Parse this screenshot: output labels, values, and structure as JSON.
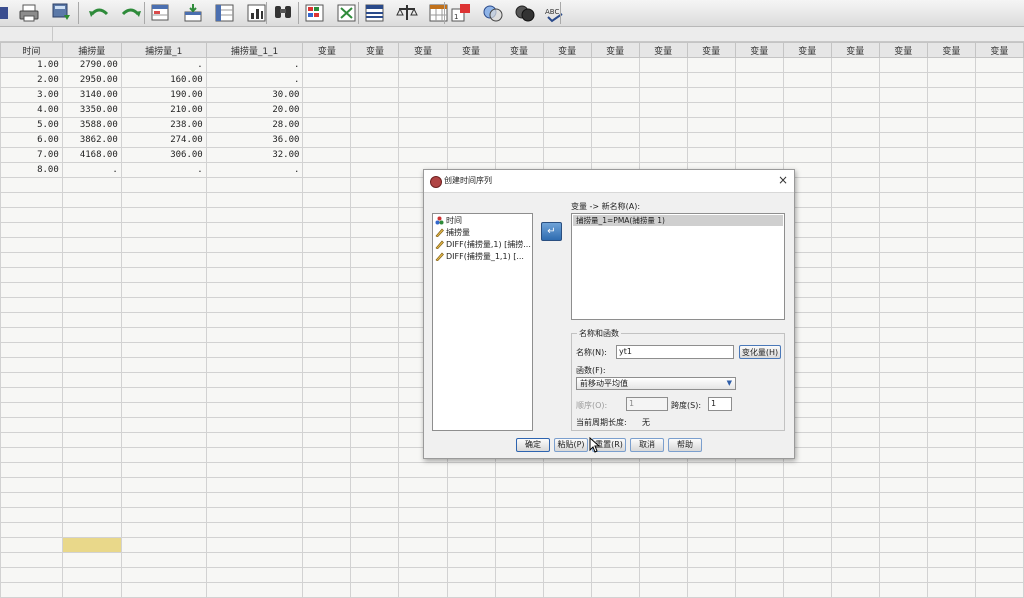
{
  "toolbar": {
    "icons": [
      "save-icon",
      "print-icon",
      "recall-dialog-icon",
      "undo-icon",
      "redo-icon",
      "goto-case-icon",
      "goto-variable-icon",
      "variables-icon",
      "run-descriptive-icon",
      "find-icon",
      "insert-cases-icon",
      "insert-variable-icon",
      "split-file-icon",
      "weight-cases-icon",
      "select-cases-icon",
      "value-labels-icon",
      "use-sets-icon",
      "show-all-variables-icon",
      "spell-check-icon"
    ],
    "spell_check_label": "ABC"
  },
  "grid": {
    "columns": [
      "时间",
      "捕捞量",
      "捕捞量_1",
      "捕捞量_1_1",
      "变量",
      "变量",
      "变量",
      "变量",
      "变量",
      "变量",
      "变量",
      "变量",
      "变量",
      "变量",
      "变量",
      "变量",
      "变量",
      "变量",
      "变量"
    ],
    "rows": [
      [
        "1.00",
        "2790.00",
        ".",
        "."
      ],
      [
        "2.00",
        "2950.00",
        "160.00",
        "."
      ],
      [
        "3.00",
        "3140.00",
        "190.00",
        "30.00"
      ],
      [
        "4.00",
        "3350.00",
        "210.00",
        "20.00"
      ],
      [
        "5.00",
        "3588.00",
        "238.00",
        "28.00"
      ],
      [
        "6.00",
        "3862.00",
        "274.00",
        "36.00"
      ],
      [
        "7.00",
        "4168.00",
        "306.00",
        "32.00"
      ],
      [
        "8.00",
        ".",
        ".",
        "."
      ]
    ]
  },
  "dialog": {
    "title": "创建时间序列",
    "close": "×",
    "source_items": [
      {
        "icon": "nominal-variable-icon",
        "label": "时间"
      },
      {
        "icon": "scale-variable-icon",
        "label": "捕捞量"
      },
      {
        "icon": "scale-variable-icon",
        "label": "DIFF(捕捞量,1) [捕捞..."
      },
      {
        "icon": "scale-variable-icon",
        "label": "DIFF(捕捞量_1,1) [..."
      }
    ],
    "move_arrow": "↵",
    "target_label": "变量 -> 新名称(A):",
    "target_items": [
      "捕捞量_1=PMA(捕捞量 1)"
    ],
    "name_function": {
      "legend": "名称和函数",
      "name_label": "名称(N):",
      "name_value": "yt1",
      "change_button": "变化量(H)",
      "function_label": "函数(F):",
      "function_value": "前移动平均值",
      "order_label": "顺序(O):",
      "order_value": "1",
      "span_label": "跨度(S):",
      "span_value": "1",
      "period_label": "当前周期长度:",
      "period_value": "无"
    },
    "buttons": {
      "ok": "确定",
      "paste": "粘贴(P)",
      "reset": "重置(R)",
      "cancel": "取消",
      "help": "帮助"
    }
  }
}
